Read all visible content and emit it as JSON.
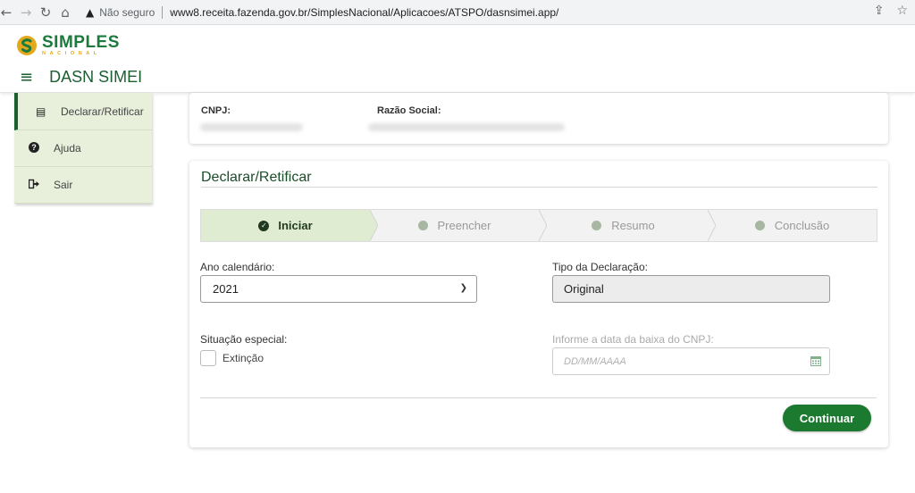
{
  "browser": {
    "security_label": "Não seguro",
    "url": "www8.receita.fazenda.gov.br/SimplesNacional/Aplicacoes/ATSPO/dasnsimei.app/"
  },
  "logo": {
    "main": "SIMPLES",
    "sub": "NACIONAL"
  },
  "header": {
    "title": "DASN SIMEI"
  },
  "sidebar": {
    "items": [
      {
        "label": "Declarar/Retificar",
        "icon": "document-icon"
      },
      {
        "label": "Ajuda",
        "icon": "question-circle-icon"
      },
      {
        "label": "Sair",
        "icon": "sign-out-icon"
      }
    ]
  },
  "company": {
    "cnpj_label": "CNPJ:",
    "razao_label": "Razão Social:"
  },
  "form": {
    "title": "Declarar/Retificar",
    "steps": [
      {
        "label": "Iniciar",
        "state": "active"
      },
      {
        "label": "Preencher",
        "state": "pending"
      },
      {
        "label": "Resumo",
        "state": "pending"
      },
      {
        "label": "Conclusão",
        "state": "pending"
      }
    ],
    "ano_label": "Ano calendário:",
    "ano_value": "2021",
    "tipo_label": "Tipo da Declaração:",
    "tipo_value": "Original",
    "situacao_label": "Situação especial:",
    "extincao_label": "Extinção",
    "data_baixa_label": "Informe a data da baixa do CNPJ:",
    "data_baixa_placeholder": "DD/MM/AAAA",
    "continue_label": "Continuar"
  },
  "colors": {
    "brand_green": "#1b7a2f",
    "brand_yellow": "#e4a91b",
    "sidebar_bg": "#e8f0dc"
  }
}
